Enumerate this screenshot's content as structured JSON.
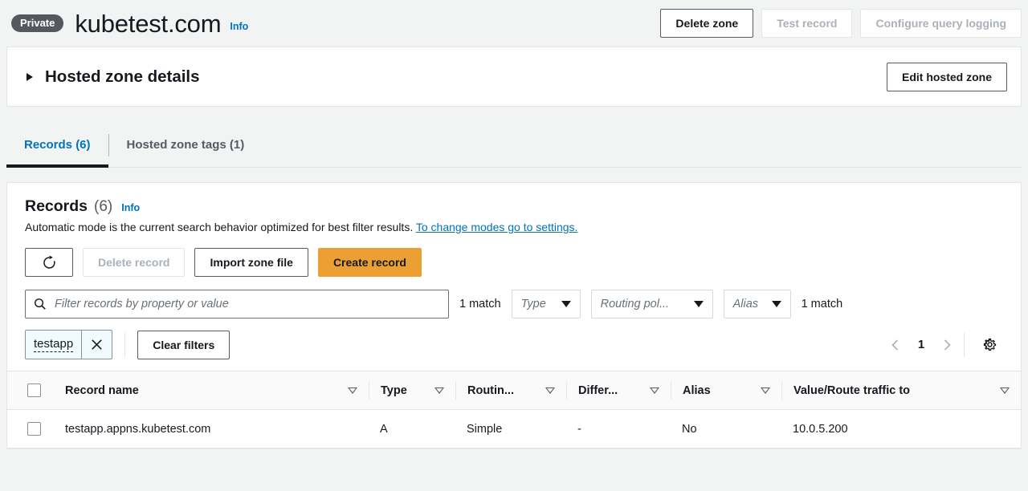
{
  "header": {
    "badge": "Private",
    "title": "kubetest.com",
    "info_label": "Info",
    "buttons": {
      "delete_zone": "Delete zone",
      "test_record": "Test record",
      "configure_query_logging": "Configure query logging"
    }
  },
  "details": {
    "title": "Hosted zone details",
    "edit_button": "Edit hosted zone"
  },
  "tabs": [
    {
      "label": "Records (6)",
      "active": true
    },
    {
      "label": "Hosted zone tags (1)",
      "active": false
    }
  ],
  "records": {
    "title": "Records",
    "count": "(6)",
    "info_label": "Info",
    "description": "Automatic mode is the current search behavior optimized for best filter results.",
    "description_link": "To change modes go to settings.",
    "actions": {
      "refresh": "refresh-icon",
      "delete_record": "Delete record",
      "import_zone_file": "Import zone file",
      "create_record": "Create record"
    },
    "filter": {
      "placeholder": "Filter records by property or value",
      "match_left": "1 match",
      "match_right": "1 match",
      "selects": [
        {
          "label": "Type"
        },
        {
          "label": "Routing pol..."
        },
        {
          "label": "Alias"
        }
      ],
      "token": "testapp",
      "clear_filters": "Clear filters"
    },
    "pagination": {
      "page": "1"
    },
    "table": {
      "columns": [
        "Record name",
        "Type",
        "Routin...",
        "Differ...",
        "Alias",
        "Value/Route traffic to"
      ],
      "rows": [
        {
          "name": "testapp.appns.kubetest.com",
          "type": "A",
          "routing": "Simple",
          "differentiator": "-",
          "alias": "No",
          "value": "10.0.5.200"
        }
      ]
    }
  },
  "colors": {
    "accent_blue": "#0073bb",
    "primary_orange": "#ec9f33",
    "badge_gray": "#54595f",
    "page_bg": "#f2f3f3"
  }
}
